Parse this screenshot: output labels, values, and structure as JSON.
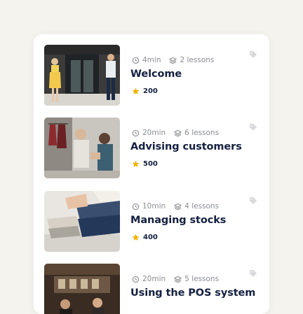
{
  "lessons": [
    {
      "duration": "4min",
      "lessons": "2 lessons",
      "title": "Welcome",
      "points": "200",
      "thumb_icon": "shop-entrance-photo"
    },
    {
      "duration": "20min",
      "lessons": "6 lessons",
      "title": "Advising customers",
      "points": "500",
      "thumb_icon": "clothing-store-photo"
    },
    {
      "duration": "10min",
      "lessons": "4 lessons",
      "title": "Managing stocks",
      "points": "400",
      "thumb_icon": "folded-clothes-photo"
    },
    {
      "duration": "20min",
      "lessons": "5 lessons",
      "title": "Using the POS system",
      "points": "",
      "thumb_icon": "pos-counter-photo"
    }
  ],
  "colors": {
    "title": "#152040",
    "meta": "#8b8d93",
    "star": "#f2b200",
    "background": "#f4f3ee"
  }
}
